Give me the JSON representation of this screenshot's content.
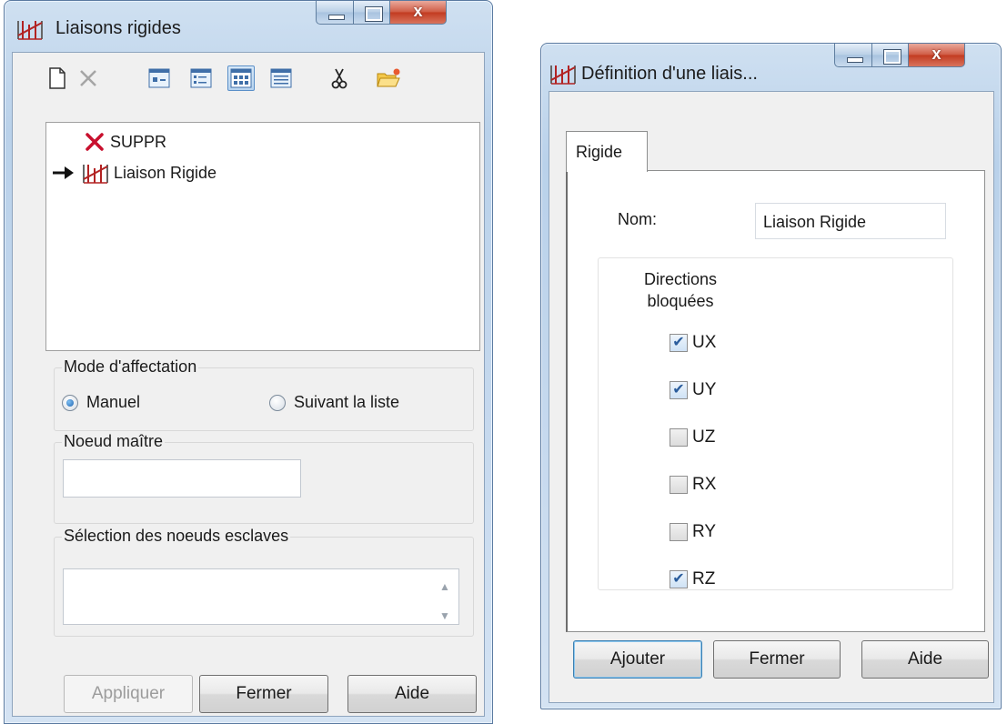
{
  "window1": {
    "title": "Liaisons rigides",
    "close_glyph": "x",
    "toolbar": {
      "icons": [
        "new-document-icon",
        "delete-icon",
        "view-small-icons-icon",
        "view-list-icon",
        "view-grid-icon",
        "view-details-icon",
        "cut-scissors-icon",
        "open-folder-icon"
      ],
      "pressed": "view-grid-icon"
    },
    "tree": {
      "items": [
        {
          "label": "SUPPR",
          "icon": "red-x-icon",
          "current": false
        },
        {
          "label": "Liaison Rigide",
          "icon": "rigid-link-icon",
          "current": true
        }
      ]
    },
    "mode_group": {
      "label": "Mode d'affectation",
      "options": [
        {
          "label": "Manuel",
          "selected": true
        },
        {
          "label": "Suivant la liste",
          "selected": false
        }
      ]
    },
    "master_group": {
      "label": "Noeud maître",
      "value": ""
    },
    "slaves_group": {
      "label": "Sélection des noeuds esclaves",
      "value": ""
    },
    "buttons": {
      "apply": "Appliquer",
      "close": "Fermer",
      "help": "Aide"
    }
  },
  "window2": {
    "title": "Définition d'une liais...",
    "close_glyph": "x",
    "tab": "Rigide",
    "name_label": "Nom:",
    "name_value": "Liaison Rigide",
    "directions_label_line1": "Directions",
    "directions_label_line2": "bloquées",
    "directions": [
      {
        "label": "UX",
        "checked": true
      },
      {
        "label": "UY",
        "checked": true
      },
      {
        "label": "UZ",
        "checked": false
      },
      {
        "label": "RX",
        "checked": false
      },
      {
        "label": "RY",
        "checked": false
      },
      {
        "label": "RZ",
        "checked": true
      }
    ],
    "buttons": {
      "add": "Ajouter",
      "close": "Fermer",
      "help": "Aide"
    }
  },
  "colors": {
    "frame": "#b9d1ea",
    "client": "#f0f0f0",
    "close_button": "#c23a20",
    "delete_mark": "#c8102e",
    "link_icon": "#b22222",
    "checkmark": "#2a5c9c"
  }
}
